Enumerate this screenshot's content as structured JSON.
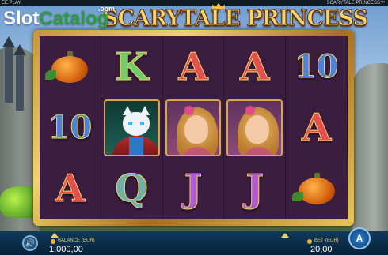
{
  "topbar": {
    "left_text": "EE PLAY",
    "right_text": "SCARYTALE PRINCESS™"
  },
  "logo": {
    "title": "SCARYTALE PRINCESS"
  },
  "watermark": {
    "slot": "Slot",
    "catalog": "Catalog",
    "com": ".com"
  },
  "reels": [
    [
      "pumpkin",
      "10",
      "A"
    ],
    [
      "K",
      "cat",
      "Q"
    ],
    [
      "A",
      "princess",
      "J"
    ],
    [
      "A",
      "princess",
      "J"
    ],
    [
      "10",
      "A",
      "pumpkin"
    ]
  ],
  "symbols_text": {
    "r1c2": "10",
    "r1c3": "A",
    "r2c1": "K",
    "r2c3": "Q",
    "r3c1": "A",
    "r3c3": "J",
    "r4c1": "A",
    "r4c3": "J",
    "r5c1": "10",
    "r5c2": "A"
  },
  "balance": {
    "label": "BALANCE",
    "currency": "(EUR)",
    "value": "1.000,00"
  },
  "bet": {
    "label": "BET",
    "currency": "(EUR)",
    "value": "20,00"
  },
  "icons": {
    "sound": "speaker-icon",
    "spin": "autoplay-spin-icon"
  },
  "colors": {
    "frame_gold": "#e9c45b",
    "reel_bg": "#3b1d3f",
    "bar_bg": "#0f3a5d"
  }
}
